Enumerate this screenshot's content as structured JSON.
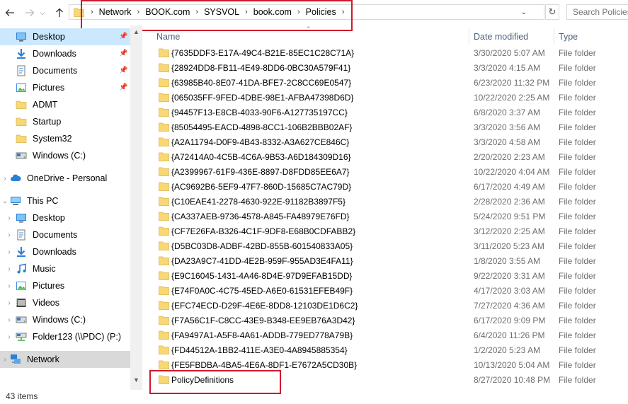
{
  "toolbar": {
    "back_icon": "back-arrow-icon",
    "forward_icon": "forward-arrow-icon",
    "recent_icon": "chevron-down-icon",
    "up_icon": "up-arrow-icon",
    "refresh_icon": "refresh-icon"
  },
  "address": {
    "crumbs": [
      "Network",
      "BOOK.com",
      "SYSVOL",
      "book.com",
      "Policies"
    ]
  },
  "search": {
    "placeholder": "Search Policies"
  },
  "sidebar": {
    "items": [
      {
        "label": "Desktop",
        "icon": "desktop-icon",
        "pinned": true,
        "selected": true
      },
      {
        "label": "Downloads",
        "icon": "download-icon",
        "pinned": true
      },
      {
        "label": "Documents",
        "icon": "documents-icon",
        "pinned": true
      },
      {
        "label": "Pictures",
        "icon": "pictures-icon",
        "pinned": true
      },
      {
        "label": "ADMT",
        "icon": "folder-icon"
      },
      {
        "label": "Startup",
        "icon": "folder-icon"
      },
      {
        "label": "System32",
        "icon": "folder-icon"
      },
      {
        "label": "Windows (C:)",
        "icon": "drive-icon"
      },
      {
        "label": "OneDrive - Personal",
        "icon": "cloud-icon"
      },
      {
        "label": "This PC",
        "icon": "computer-icon"
      },
      {
        "label": "Desktop",
        "icon": "desktop-icon"
      },
      {
        "label": "Documents",
        "icon": "documents-icon"
      },
      {
        "label": "Downloads",
        "icon": "download-icon"
      },
      {
        "label": "Music",
        "icon": "music-icon"
      },
      {
        "label": "Pictures",
        "icon": "pictures-icon"
      },
      {
        "label": "Videos",
        "icon": "videos-icon"
      },
      {
        "label": "Windows (C:)",
        "icon": "drive-icon"
      },
      {
        "label": "Folder123 (\\\\PDC) (P:)",
        "icon": "network-drive-icon"
      },
      {
        "label": "Network",
        "icon": "network-icon",
        "selected": true
      }
    ]
  },
  "columns": {
    "name": "Name",
    "date": "Date modified",
    "type": "Type"
  },
  "files": [
    {
      "name": "{7635DDF3-E17A-49C4-B21E-85EC1C28C71A}",
      "date": "3/30/2020 5:07 AM",
      "type": "File folder"
    },
    {
      "name": "{28924DD8-FB11-4E49-8DD6-0BC30A579F41}",
      "date": "3/3/2020 4:15 AM",
      "type": "File folder"
    },
    {
      "name": "{63985B40-8E07-41DA-BFE7-2C8CC69E0547}",
      "date": "6/23/2020 11:32 PM",
      "type": "File folder"
    },
    {
      "name": "{065035FF-9FED-4DBE-98E1-AFBA47398D6D}",
      "date": "10/22/2020 2:25 AM",
      "type": "File folder"
    },
    {
      "name": "{94457F13-E8CB-4033-90F6-A127735197CC}",
      "date": "6/8/2020 3:37 AM",
      "type": "File folder"
    },
    {
      "name": "{85054495-EACD-4898-8CC1-106B2BBB02AF}",
      "date": "3/3/2020 3:56 AM",
      "type": "File folder"
    },
    {
      "name": "{A2A11794-D0F9-4B43-8332-A3A627CE846C}",
      "date": "3/3/2020 4:58 AM",
      "type": "File folder"
    },
    {
      "name": "{A72414A0-4C5B-4C6A-9B53-A6D184309D16}",
      "date": "2/20/2020 2:23 AM",
      "type": "File folder"
    },
    {
      "name": "{A2399967-61F9-436E-8897-D8FDD85EE6A7}",
      "date": "10/22/2020 4:04 AM",
      "type": "File folder"
    },
    {
      "name": "{AC9692B6-5EF9-47F7-860D-15685C7AC79D}",
      "date": "6/17/2020 4:49 AM",
      "type": "File folder"
    },
    {
      "name": "{C10EAE41-2278-4630-922E-91182B3897F5}",
      "date": "2/28/2020 2:36 AM",
      "type": "File folder"
    },
    {
      "name": "{CA337AEB-9736-4578-A845-FA48979E76FD}",
      "date": "5/24/2020 9:51 PM",
      "type": "File folder"
    },
    {
      "name": "{CF7E26FA-B326-4C1F-9DF8-E68B0CDFABB2}",
      "date": "3/12/2020 2:25 AM",
      "type": "File folder"
    },
    {
      "name": "{D5BC03D8-ADBF-42BD-855B-601540833A05}",
      "date": "3/11/2020 5:23 AM",
      "type": "File folder"
    },
    {
      "name": "{DA23A9C7-41DD-4E2B-959F-955AD3E4FA11}",
      "date": "1/8/2020 3:55 AM",
      "type": "File folder"
    },
    {
      "name": "{E9C16045-1431-4A46-8D4E-97D9EFAB15DD}",
      "date": "9/22/2020 3:31 AM",
      "type": "File folder"
    },
    {
      "name": "{E74F0A0C-4C75-45ED-A6E0-61531EFEB49F}",
      "date": "4/17/2020 3:03 AM",
      "type": "File folder"
    },
    {
      "name": "{EFC74ECD-D29F-4E6E-8DD8-12103DE1D6C2}",
      "date": "7/27/2020 4:36 AM",
      "type": "File folder"
    },
    {
      "name": "{F7A56C1F-C8CC-43E9-B348-EE9EB76A3D42}",
      "date": "6/17/2020 9:09 PM",
      "type": "File folder"
    },
    {
      "name": "{FA9497A1-A5F8-4A61-ADDB-779ED778A79B}",
      "date": "6/4/2020 11:26 PM",
      "type": "File folder"
    },
    {
      "name": "{FD44512A-1BB2-411E-A3E0-4A8945885354}",
      "date": "1/2/2020 5:23 AM",
      "type": "File folder"
    },
    {
      "name": "{FE5FBDBA-4BA5-4E6A-8DF1-E7672A5CD30B}",
      "date": "10/13/2020 5:04 AM",
      "type": "File folder"
    },
    {
      "name": "PolicyDefinitions",
      "date": "8/27/2020 10:48 PM",
      "type": "File folder"
    }
  ],
  "status": {
    "item_count": "43 items"
  },
  "colors": {
    "highlight": "#d0192c",
    "selection": "#cce8ff",
    "folder": "#f8d775"
  }
}
